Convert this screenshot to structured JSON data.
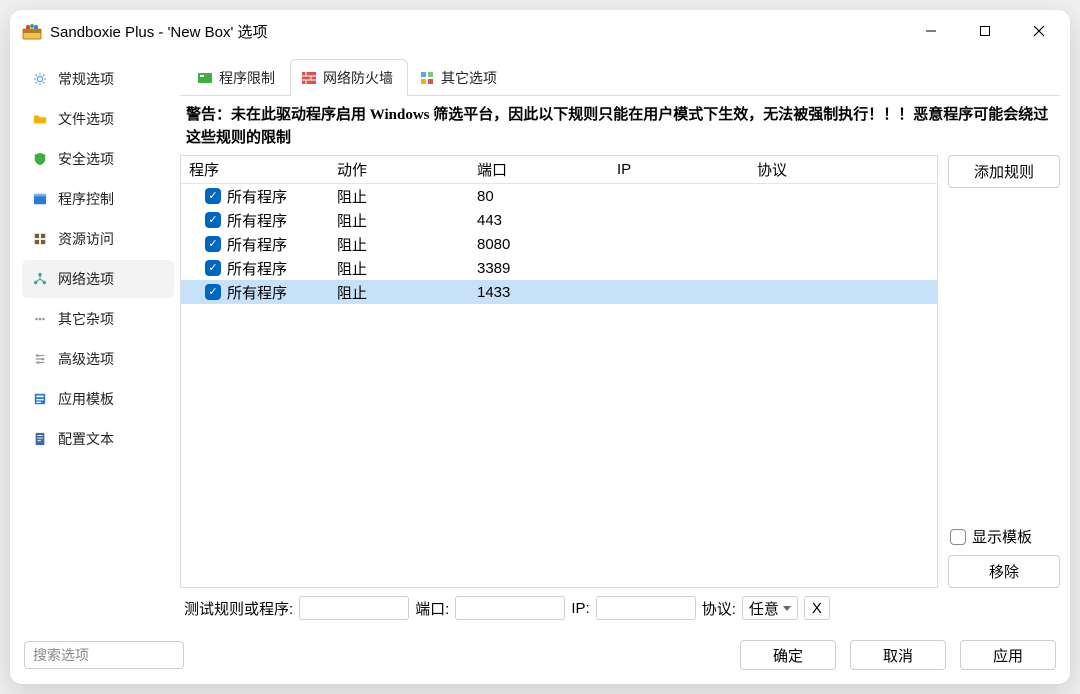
{
  "window": {
    "title": "Sandboxie Plus - 'New Box' 选项"
  },
  "sidebar": {
    "items": [
      {
        "label": "常规选项",
        "icon": "gear-icon",
        "color": "#5aa3e8"
      },
      {
        "label": "文件选项",
        "icon": "folder-icon",
        "color": "#f0b400"
      },
      {
        "label": "安全选项",
        "icon": "shield-icon",
        "color": "#3fae3f"
      },
      {
        "label": "程序控制",
        "icon": "window-icon",
        "color": "#2e7bd6"
      },
      {
        "label": "资源访问",
        "icon": "resource-icon",
        "color": "#7a5c3e"
      },
      {
        "label": "网络选项",
        "icon": "network-icon",
        "color": "#4aa3a3"
      },
      {
        "label": "其它杂项",
        "icon": "misc-icon",
        "color": "#999999"
      },
      {
        "label": "高级选项",
        "icon": "advanced-icon",
        "color": "#999999"
      },
      {
        "label": "应用模板",
        "icon": "template-icon",
        "color": "#2e7bd6"
      },
      {
        "label": "配置文本",
        "icon": "config-icon",
        "color": "#3b6fa0"
      }
    ],
    "selected_index": 5
  },
  "tabs": {
    "items": [
      {
        "label": "程序限制",
        "icon": "app-block-icon"
      },
      {
        "label": "网络防火墙",
        "icon": "firewall-icon"
      },
      {
        "label": "其它选项",
        "icon": "other-icon"
      }
    ],
    "active_index": 1
  },
  "warning": "警告：未在此驱动程序启用 Windows 筛选平台，因此以下规则只能在用户模式下生效，无法被强制执行！！！恶意程序可能会绕过这些规则的限制",
  "table": {
    "columns": {
      "program": "程序",
      "action": "动作",
      "port": "端口",
      "ip": "IP",
      "protocol": "协议"
    },
    "rows": [
      {
        "checked": true,
        "program": "所有程序",
        "action": "阻止",
        "port": "80",
        "ip": "",
        "protocol": ""
      },
      {
        "checked": true,
        "program": "所有程序",
        "action": "阻止",
        "port": "443",
        "ip": "",
        "protocol": ""
      },
      {
        "checked": true,
        "program": "所有程序",
        "action": "阻止",
        "port": "8080",
        "ip": "",
        "protocol": ""
      },
      {
        "checked": true,
        "program": "所有程序",
        "action": "阻止",
        "port": "3389",
        "ip": "",
        "protocol": ""
      },
      {
        "checked": true,
        "program": "所有程序",
        "action": "阻止",
        "port": "1433",
        "ip": "",
        "protocol": ""
      }
    ],
    "selected_row_index": 4
  },
  "right_panel": {
    "add_rule": "添加规则",
    "show_templates": "显示模板",
    "show_templates_checked": false,
    "remove": "移除"
  },
  "test_row": {
    "label": "测试规则或程序:",
    "program_value": "",
    "port_label": "端口:",
    "port_value": "",
    "ip_label": "IP:",
    "ip_value": "",
    "protocol_label": "协议:",
    "protocol_value": "任意",
    "clear_label": "X"
  },
  "footer": {
    "search_placeholder": "搜索选项",
    "ok": "确定",
    "cancel": "取消",
    "apply": "应用"
  }
}
